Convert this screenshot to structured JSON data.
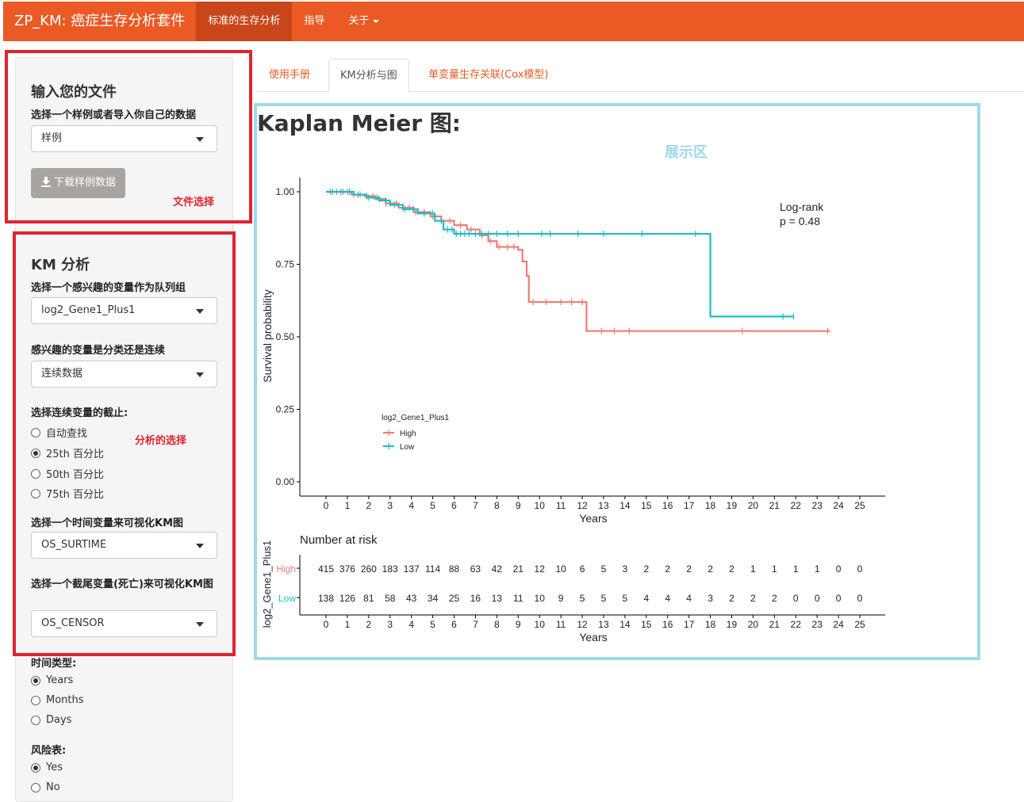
{
  "navbar": {
    "brand": "ZP_KM: 癌症生存分析套件",
    "items": [
      {
        "label": "标准的生存分析",
        "active": true
      },
      {
        "label": "指导",
        "active": false
      },
      {
        "label": "关于",
        "active": false
      }
    ]
  },
  "sidebar": {
    "file_section": {
      "title": "输入您的文件",
      "select_label": "选择一个样例或者导入你自己的数据",
      "select_value": "样例",
      "download_label": "下载样例数据",
      "annotation": "文件选择"
    },
    "km_section": {
      "title": "KM 分析",
      "cohort_label": "选择一个感兴趣的变量作为队列组",
      "cohort_value": "log2_Gene1_Plus1",
      "type_label": "感兴趣的变量是分类还是连续",
      "type_value": "连续数据",
      "cutoff_label": "选择连续变量的截止:",
      "cutoff_options": [
        "自动查找",
        "25th 百分比",
        "50th 百分比",
        "75th 百分比"
      ],
      "cutoff_selected": 1,
      "annotation": "分析的选择",
      "time_label": "选择一个时间变量来可视化KM图",
      "time_value": "OS_SURTIME",
      "censor_label": "选择一个截尾变量(死亡)来可视化KM图",
      "censor_value": "OS_CENSOR",
      "time_type_label": "时间类型:",
      "time_type_options": [
        "Years",
        "Months",
        "Days"
      ],
      "time_type_selected": 0,
      "risk_label": "风险表:",
      "risk_options": [
        "Yes",
        "No"
      ],
      "risk_selected": 0
    }
  },
  "tabs": [
    {
      "label": "使用手册",
      "active": false
    },
    {
      "label": "KM分析与图",
      "active": true
    },
    {
      "label": "单变量生存关联(Cox模型)",
      "active": false
    }
  ],
  "main": {
    "title": "Kaplan Meier 图:",
    "annotation": "展示区"
  },
  "colors": {
    "high": "#f07c77",
    "low": "#19bfc4",
    "accent": "#eb5a24"
  },
  "chart_data": {
    "type": "line",
    "subtype": "kaplan-meier",
    "xlabel": "Years",
    "ylabel": "Survival probability",
    "xlim": [
      0,
      25
    ],
    "ylim": [
      0,
      1
    ],
    "xticks": [
      0,
      1,
      2,
      3,
      4,
      5,
      6,
      7,
      8,
      9,
      10,
      11,
      12,
      13,
      14,
      15,
      16,
      17,
      18,
      19,
      20,
      21,
      22,
      23,
      24,
      25
    ],
    "yticks": [
      "0.00",
      "0.25",
      "0.50",
      "0.75",
      "1.00"
    ],
    "grid": false,
    "annotation": [
      "Log-rank",
      "p = 0.48"
    ],
    "legend": {
      "title": "log2_Gene1_Plus1",
      "position": "left-lower",
      "entries": [
        "High",
        "Low"
      ]
    },
    "series": [
      {
        "name": "High",
        "steps": [
          [
            0,
            1.0
          ],
          [
            1.2,
            0.99
          ],
          [
            1.8,
            0.985
          ],
          [
            2.3,
            0.975
          ],
          [
            2.8,
            0.96
          ],
          [
            3.4,
            0.945
          ],
          [
            4.1,
            0.93
          ],
          [
            4.9,
            0.915
          ],
          [
            5.4,
            0.9
          ],
          [
            6.0,
            0.885
          ],
          [
            6.6,
            0.87
          ],
          [
            7.2,
            0.85
          ],
          [
            7.6,
            0.83
          ],
          [
            8.0,
            0.81
          ],
          [
            9.0,
            0.8
          ],
          [
            9.2,
            0.76
          ],
          [
            9.4,
            0.71
          ],
          [
            9.5,
            0.62
          ],
          [
            12.2,
            0.52
          ],
          [
            23.6,
            0.52
          ]
        ],
        "censors": [
          0.2,
          0.5,
          0.8,
          1.0,
          1.3,
          1.6,
          1.9,
          2.2,
          2.5,
          2.8,
          3.0,
          3.3,
          3.6,
          3.9,
          4.2,
          4.6,
          5.0,
          5.4,
          5.8,
          6.3,
          6.8,
          7.3,
          7.7,
          8.1,
          8.5,
          8.8,
          9.7,
          10.3,
          11.0,
          11.5,
          12.0,
          12.9,
          13.5,
          14.2,
          19.5,
          23.5
        ]
      },
      {
        "name": "Low",
        "steps": [
          [
            0,
            1.0
          ],
          [
            1.3,
            0.99
          ],
          [
            1.9,
            0.98
          ],
          [
            2.5,
            0.97
          ],
          [
            3.0,
            0.955
          ],
          [
            3.6,
            0.94
          ],
          [
            4.3,
            0.925
          ],
          [
            5.1,
            0.9
          ],
          [
            5.5,
            0.87
          ],
          [
            6.0,
            0.855
          ],
          [
            18.0,
            0.855
          ],
          [
            18.0,
            0.57
          ],
          [
            21.9,
            0.57
          ]
        ],
        "censors": [
          0.3,
          0.7,
          1.1,
          1.5,
          2.0,
          2.4,
          2.8,
          3.2,
          3.7,
          4.1,
          4.6,
          5.0,
          5.4,
          5.7,
          5.9,
          6.1,
          6.3,
          6.5,
          6.7,
          7.0,
          7.3,
          7.6,
          8.0,
          8.5,
          9.0,
          10.1,
          10.5,
          11.8,
          13.0,
          14.8,
          17.3,
          21.4,
          21.9
        ]
      }
    ],
    "risk_table": {
      "title": "Number at risk",
      "ylabel": "log2_Gene1_Plus1",
      "xlabel": "Years",
      "rows": [
        {
          "name": "High",
          "values": [
            415,
            376,
            260,
            183,
            137,
            114,
            88,
            63,
            42,
            21,
            12,
            10,
            6,
            5,
            3,
            2,
            2,
            2,
            2,
            2,
            1,
            1,
            1,
            1,
            0,
            0
          ]
        },
        {
          "name": "Low",
          "values": [
            138,
            126,
            81,
            58,
            43,
            34,
            25,
            16,
            13,
            11,
            10,
            9,
            5,
            5,
            5,
            4,
            4,
            4,
            3,
            2,
            2,
            2,
            0,
            0,
            0,
            0
          ]
        }
      ]
    }
  }
}
